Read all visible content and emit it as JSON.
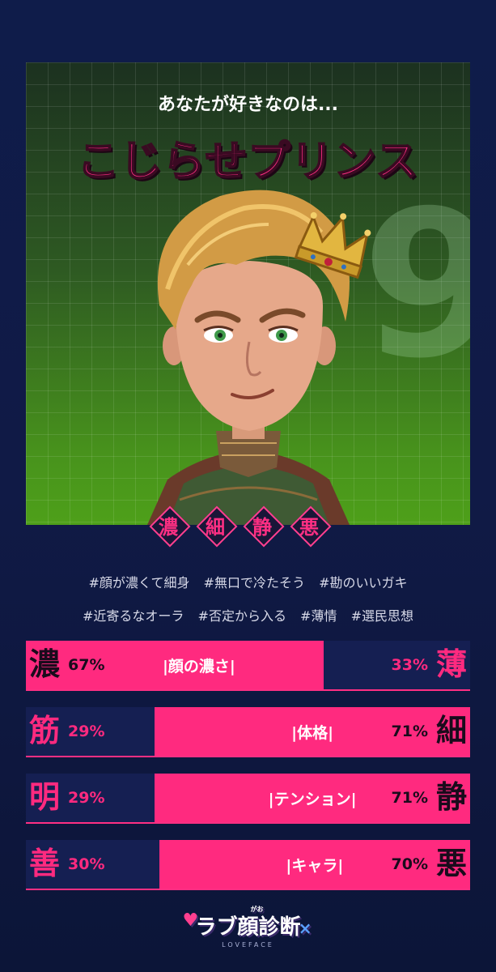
{
  "result": {
    "lead_text": "あなたが好きなのは...",
    "type_name": "こじらせプリンス",
    "background_glyph": "9",
    "badges": [
      "濃",
      "細",
      "静",
      "悪"
    ]
  },
  "tags": {
    "row1": [
      "#顔が濃くて細身",
      "#無口で冷たそう",
      "#勘のいいガキ"
    ],
    "row2": [
      "#近寄るなオーラ",
      "#否定から入る",
      "#薄情",
      "#選民思想"
    ]
  },
  "meters": [
    {
      "label": "|顔の濃さ|",
      "left_kanji": "濃",
      "left_pct": "67%",
      "right_pct": "33%",
      "right_kanji": "薄",
      "left_value": 67
    },
    {
      "label": "|体格|",
      "left_kanji": "筋",
      "left_pct": "29%",
      "right_pct": "71%",
      "right_kanji": "細",
      "left_value": 29
    },
    {
      "label": "|テンション|",
      "left_kanji": "明",
      "left_pct": "29%",
      "right_pct": "71%",
      "right_kanji": "静",
      "left_value": 29
    },
    {
      "label": "|キャラ|",
      "left_kanji": "善",
      "left_pct": "30%",
      "right_pct": "70%",
      "right_kanji": "悪",
      "left_value": 30
    }
  ],
  "footer": {
    "logo_text": "ラブ顔診断",
    "logo_ruby": "がお",
    "logo_subtext": "LOVEFACE"
  },
  "colors": {
    "accent": "#ff2a7f",
    "bar_dark": "#151f52",
    "page_bg": "#0f1c4a"
  }
}
